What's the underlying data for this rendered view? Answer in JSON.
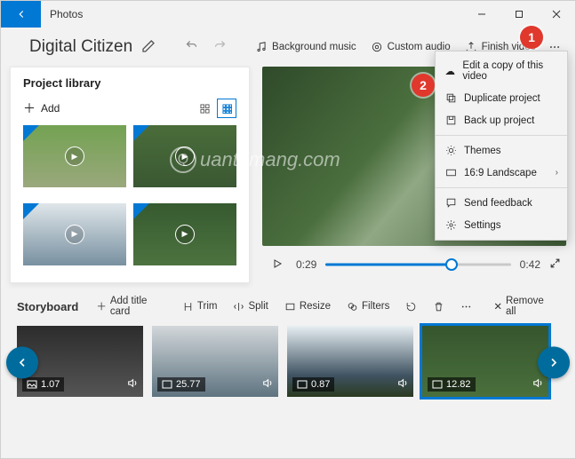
{
  "app_title": "Photos",
  "project_name": "Digital Citizen",
  "toolbar": {
    "bg_music": "Background music",
    "custom_audio": "Custom audio",
    "finish": "Finish video"
  },
  "more_menu": {
    "sync": "Edit a copy of this video",
    "duplicate": "Duplicate project",
    "backup": "Back up project",
    "themes": "Themes",
    "aspect": "16:9 Landscape",
    "feedback": "Send feedback",
    "settings": "Settings"
  },
  "library": {
    "title": "Project library",
    "add": "Add"
  },
  "player": {
    "current": "0:29",
    "duration": "0:42"
  },
  "storyboard": {
    "title": "Storyboard",
    "add_title": "Add title card",
    "trim": "Trim",
    "split": "Split",
    "resize": "Resize",
    "filters": "Filters",
    "remove_all": "Remove all",
    "clips": [
      {
        "dur": "1.07"
      },
      {
        "dur": "25.77"
      },
      {
        "dur": "0.87"
      },
      {
        "dur": "12.82"
      }
    ]
  },
  "annotations": {
    "a1": "1",
    "a2": "2"
  },
  "watermark": {
    "brand": "uantrimang.com",
    "letter": "Q"
  }
}
